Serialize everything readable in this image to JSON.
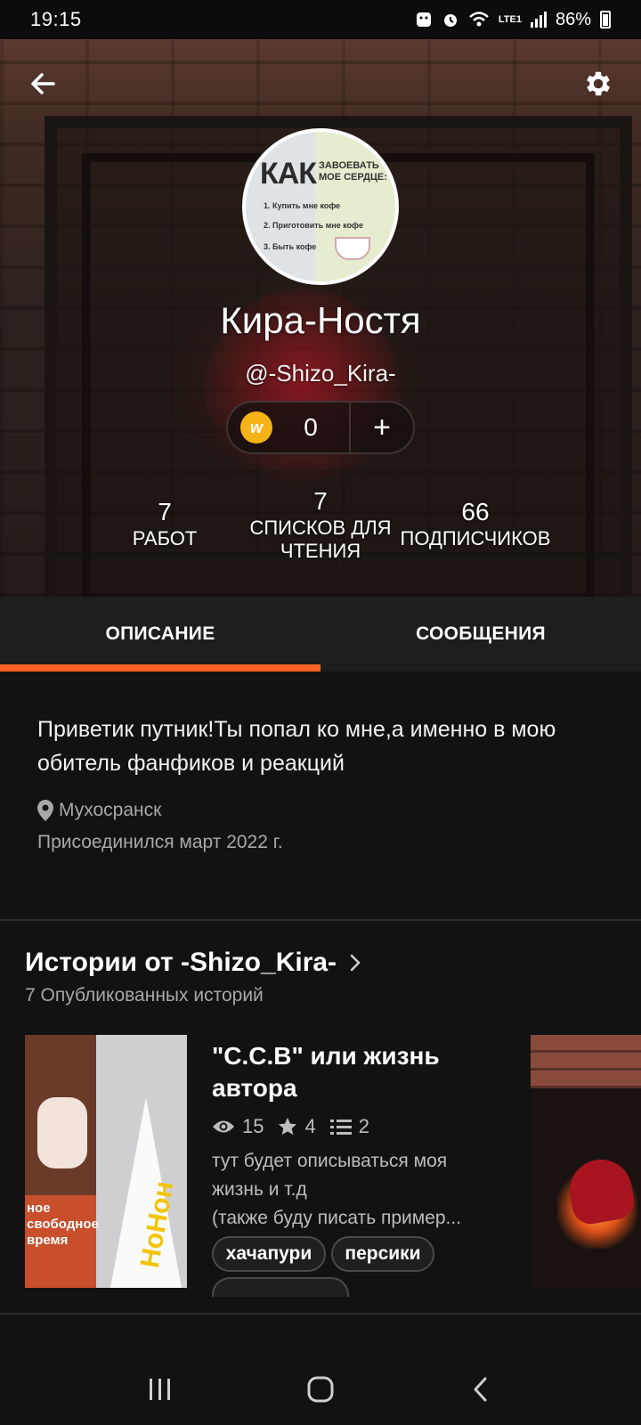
{
  "status_bar": {
    "time": "19:15",
    "battery": "86%",
    "network": "LTE1",
    "icons": [
      "face-unlock-icon",
      "alarm-icon",
      "wifi-icon",
      "volte-icon",
      "signal-icon",
      "battery-icon"
    ]
  },
  "header": {
    "back_icon": "arrow-left-icon",
    "settings_icon": "gear-icon",
    "avatar": {
      "headline": "КАК",
      "subheadline": "ЗАВОЕВАТЬ МОЕ СЕРДЦЕ:",
      "lines": [
        "1. Купить мне кофе",
        "2. Приготовить мне кофе",
        "3. Быть кофе"
      ]
    },
    "name": "Кира-Ностя",
    "handle": "@-Shizo_Kira-",
    "coins": {
      "icon_letter": "w",
      "count": "0",
      "add_label": "+"
    },
    "stats": [
      {
        "value": "7",
        "label": "РАБОТ"
      },
      {
        "value": "7",
        "label": "СПИСКОВ ДЛЯ ЧТЕНИЯ"
      },
      {
        "value": "66",
        "label": "ПОДПИСЧИКОВ"
      }
    ]
  },
  "tabs": [
    {
      "label": "ОПИСАНИЕ",
      "active": true
    },
    {
      "label": "СООБЩЕНИЯ",
      "active": false
    }
  ],
  "about": {
    "description": "Приветик путник!Ты попал ко мне,а именно в мою обитель фанфиков и реакций",
    "location": "Мухосранск",
    "joined": "Присоединился март 2022 г."
  },
  "stories": {
    "title": "Истории от -Shizo_Kira-",
    "subtitle": "7 Опубликованных историй",
    "items": [
      {
        "title": "\"С.С.В\" или жизнь автора",
        "reads": "15",
        "votes": "4",
        "parts": "2",
        "description_lines": [
          "тут будет описываться моя",
          "жизнь и т.д",
          "(также буду писать пример..."
        ],
        "tags": [
          "хачапури",
          "персики"
        ],
        "cover_text": "НоНон",
        "cover_caption": "ное свободное время"
      }
    ]
  },
  "nav": {
    "recent_icon": "recent-apps-icon",
    "home_icon": "home-icon",
    "back_icon": "back-icon"
  },
  "colors": {
    "accent": "#ff6122",
    "background": "#121212",
    "tab_bar": "#1e1e1e",
    "coin": "#f5b315"
  }
}
